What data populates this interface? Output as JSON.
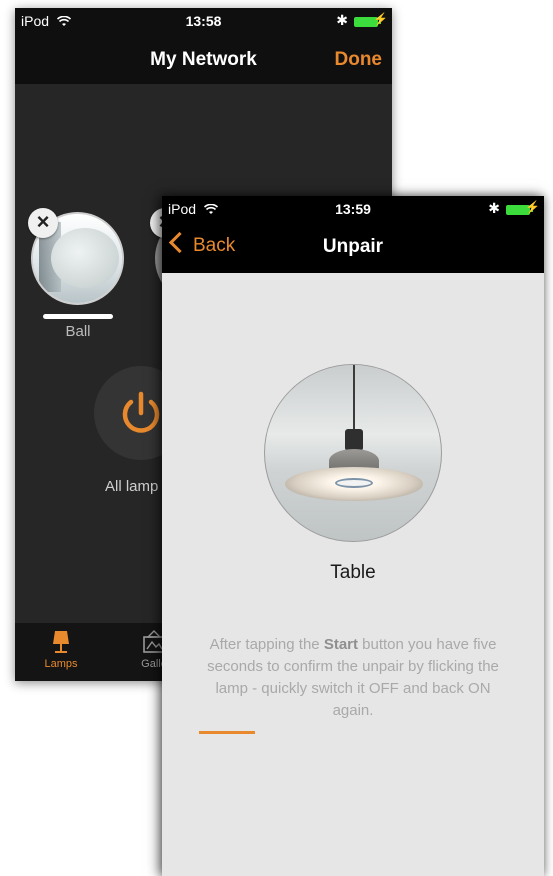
{
  "back_screen": {
    "status": {
      "carrier": "iPod",
      "time": "13:58"
    },
    "nav": {
      "title": "My Network",
      "done_label": "Done"
    },
    "lamps": [
      {
        "name": "Ball",
        "selected": true
      }
    ],
    "all_lamps_label": "All lamp",
    "tabs": [
      {
        "label": "Lamps",
        "icon": "lamp-icon",
        "active": true
      },
      {
        "label": "Galle",
        "icon": "gallery-icon",
        "active": false
      }
    ],
    "accent_color": "#e8892e"
  },
  "front_screen": {
    "status": {
      "carrier": "iPod",
      "time": "13:59"
    },
    "nav": {
      "back_label": "Back",
      "title": "Unpair"
    },
    "lamp_name": "Table",
    "instructions": {
      "before": "After tapping the ",
      "emphasis": "Start",
      "after": " button you have five seconds to confirm the unpair by flicking the lamp - quickly switch it OFF and back ON again."
    },
    "progress_fraction": 0.18,
    "accent_color": "#e8892e"
  }
}
